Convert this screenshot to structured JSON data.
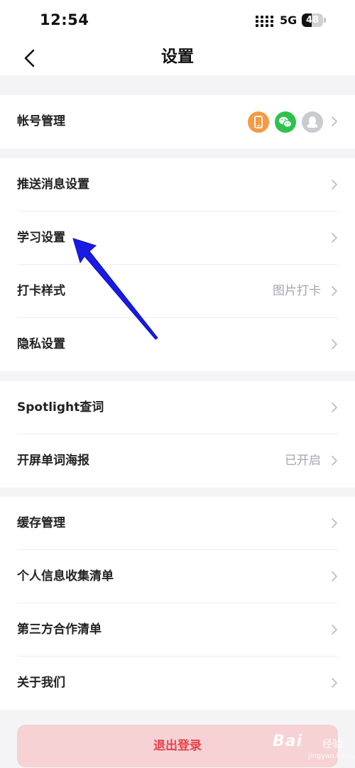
{
  "status_bar": {
    "time": "12:54",
    "network": "5G",
    "battery": "48",
    "battery_level": 0.48
  },
  "nav": {
    "title": "设置"
  },
  "groups": [
    {
      "items": [
        {
          "label": "帐号管理",
          "linked_accounts": [
            "phone-icon",
            "wechat-icon",
            "qq-icon"
          ]
        }
      ]
    },
    {
      "items": [
        {
          "label": "推送消息设置",
          "value": ""
        },
        {
          "label": "学习设置",
          "value": ""
        },
        {
          "label": "打卡样式",
          "value": "图片打卡"
        },
        {
          "label": "隐私设置",
          "value": ""
        }
      ]
    },
    {
      "items": [
        {
          "label": "Spotlight查词",
          "value": ""
        },
        {
          "label": "开屏单词海报",
          "value": "已开启"
        }
      ]
    },
    {
      "items": [
        {
          "label": "缓存管理",
          "value": ""
        },
        {
          "label": "个人信息收集清单",
          "value": ""
        },
        {
          "label": "第三方合作清单",
          "value": ""
        },
        {
          "label": "关于我们",
          "value": ""
        }
      ]
    }
  ],
  "logout": {
    "label": "退出登录"
  },
  "watermark": {
    "brand": "Bai",
    "sub": "经验",
    "url": "jingyan.baidu.com"
  },
  "colors": {
    "accent_red": "#e8424b",
    "logout_bg": "#f6d2d4",
    "phone_icon": "#f59a45",
    "wechat_icon": "#2ec24c",
    "qq_icon": "#c9cbd0",
    "annotation_arrow": "#1a1ae6"
  }
}
